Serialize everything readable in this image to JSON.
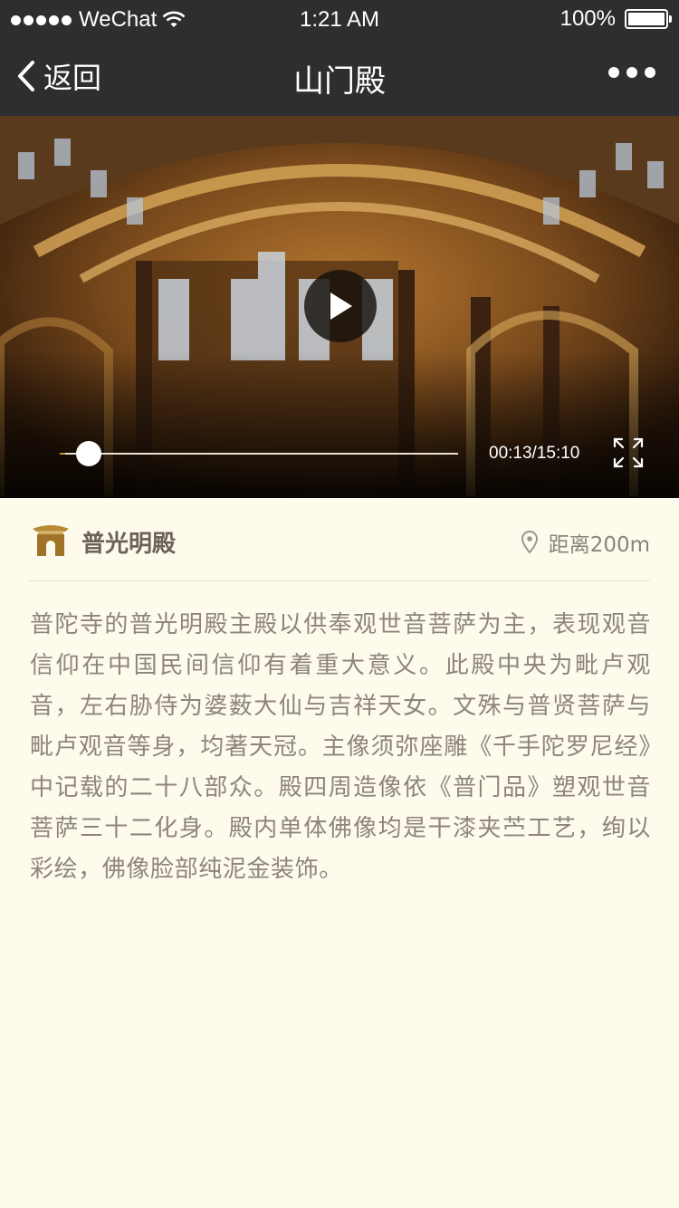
{
  "status_bar": {
    "carrier": "WeChat",
    "time": "1:21 AM",
    "battery": "100%"
  },
  "nav": {
    "back_label": "返回",
    "title": "山门殿",
    "more_icon": "more-icon"
  },
  "video": {
    "time_readout": "00:13/15:10",
    "progress": 0.014,
    "icons": {
      "play": "play-icon",
      "fullscreen": "fullscreen-icon"
    }
  },
  "location": {
    "icon": "temple-icon",
    "hall_name": "普光明殿",
    "distance": "距离200m",
    "distance_icon": "location-pin-icon"
  },
  "description": "普陀寺的普光明殿主殿以供奉观世音菩萨为主，表现观音信仰在中国民间信仰有着重大意义。此殿中央为毗卢观音，左右胁侍为婆薮大仙与吉祥天女。文殊与普贤菩萨与毗卢观音等身，均著天冠。主像须弥座雕《千手陀罗尼经》中记载的二十八部众。殿四周造像依《普门品》塑观世音菩萨三十二化身。殿内单体佛像均是干漆夹苎工艺，绚以彩绘，佛像脸部纯泥金装饰。",
  "colors": {
    "nav_background": "#2d2e30",
    "page_background": "#fefbed",
    "accent_gold": "#c49a30",
    "text_body": "#8d857c"
  }
}
